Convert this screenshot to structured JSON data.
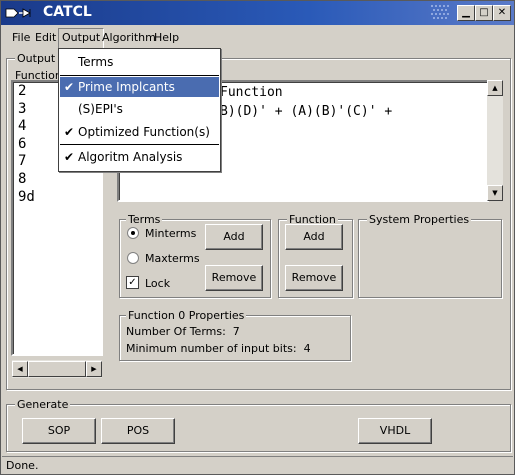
{
  "window": {
    "title": "CATCL"
  },
  "menubar": [
    "File",
    "Edit",
    "Output",
    "Algorithm",
    "Help"
  ],
  "output_menu": {
    "items": [
      {
        "label": "Terms",
        "checked": false,
        "highlighted": false
      },
      {
        "label": "Prime Implcants",
        "checked": true,
        "highlighted": true
      },
      {
        "label": "(S)EPI's",
        "checked": false,
        "highlighted": false
      },
      {
        "label": "Optimized Function(s)",
        "checked": true,
        "highlighted": false
      },
      {
        "label": "Algoritm Analysis",
        "checked": true,
        "highlighted": false
      }
    ]
  },
  "output_panel": {
    "title": "Output F",
    "list_header": "Function L",
    "list_items": [
      "2",
      "3",
      "4",
      "6",
      "7",
      "8",
      "9d"
    ]
  },
  "text_area": {
    "line1": "Function",
    "line2": "B)(D)' + (A)(B)'(C)' +"
  },
  "terms_group": {
    "title": "Terms",
    "minterms_label": "Minterms",
    "maxterms_label": "Maxterms",
    "lock_label": "Lock",
    "add_label": "Add",
    "remove_label": "Remove"
  },
  "function_group": {
    "title": "Function",
    "add_label": "Add",
    "remove_label": "Remove"
  },
  "system_properties": {
    "title": "System Properties"
  },
  "function_properties": {
    "title": "Function 0 Properties",
    "num_terms": "Number Of Terms:  7",
    "min_bits": "Minimum number of input bits:  4"
  },
  "generate": {
    "title": "Generate",
    "sop_label": "SOP",
    "pos_label": "POS",
    "vhdl_label": "VHDL"
  },
  "status": "Done."
}
